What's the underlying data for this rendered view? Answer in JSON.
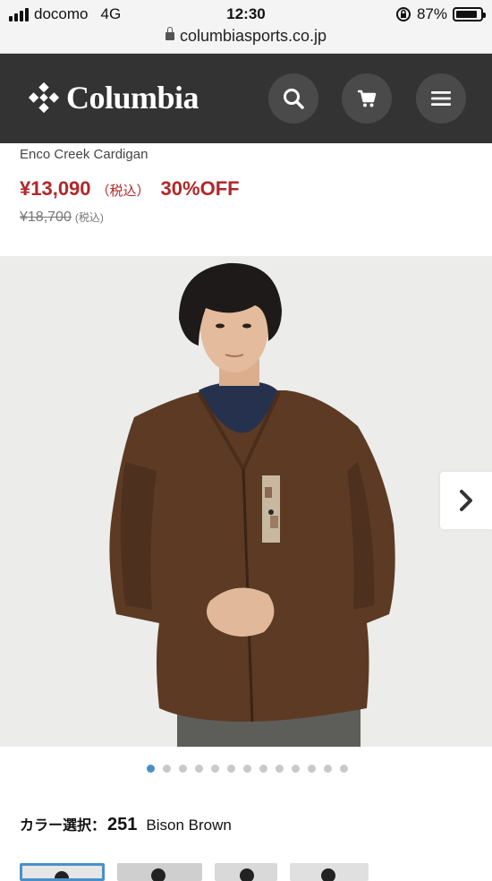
{
  "status_bar": {
    "carrier": "docomo",
    "network": "4G",
    "time": "12:30",
    "battery": "87%"
  },
  "browser": {
    "url": "columbiasports.co.jp"
  },
  "header": {
    "brand": "Columbia",
    "icons": [
      "search-icon",
      "cart-icon",
      "menu-icon"
    ]
  },
  "product": {
    "name": "Enco Creek Cardigan",
    "sale_price": "¥13,090",
    "tax_label": "（税込）",
    "discount": "30%OFF",
    "original_price": "¥18,700",
    "original_tax_label": "(税込)"
  },
  "gallery": {
    "image_count": 13,
    "active_index": 0
  },
  "color_select": {
    "label": "カラー選択：",
    "code": "251",
    "name": "Bison Brown"
  },
  "colors": {
    "accent": "#b1272a",
    "header_bg": "#333333",
    "active_dot": "#4a90c8"
  }
}
